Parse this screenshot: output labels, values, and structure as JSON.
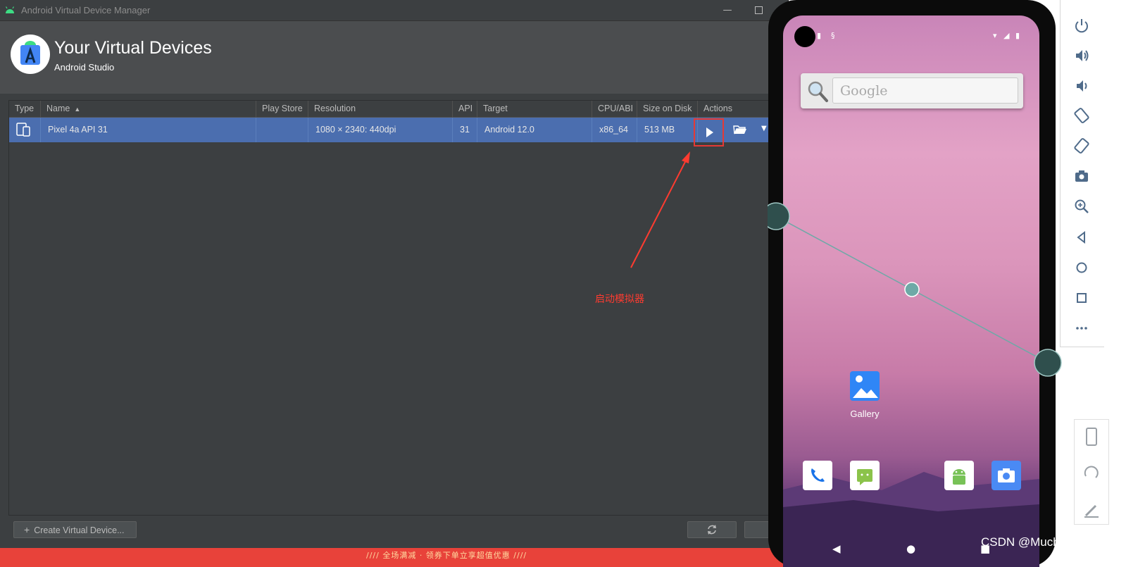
{
  "window": {
    "title": "Android Virtual Device Manager"
  },
  "header": {
    "title": "Your Virtual Devices",
    "subtitle": "Android Studio"
  },
  "table": {
    "columns": [
      "Type",
      "Name",
      "Play Store",
      "Resolution",
      "API",
      "Target",
      "CPU/ABI",
      "Size on Disk",
      "Actions"
    ],
    "sort_column": "Name",
    "rows": [
      {
        "type_icon": "phone-tablet-icon",
        "name": "Pixel 4a API 31",
        "play_store": "",
        "resolution": "1080 × 2340: 440dpi",
        "api": "31",
        "target": "Android 12.0",
        "cpu_abi": "x86_64",
        "size": "513 MB",
        "actions": [
          "play-icon",
          "folder-open-icon",
          "chevron-down-icon"
        ]
      }
    ]
  },
  "footer": {
    "create_label": "Create Virtual Device...",
    "refresh_icon": "refresh-icon"
  },
  "annotation": {
    "text": "启动模拟器",
    "color": "#ff3b30"
  },
  "ad_strip": {
    "text": "//// 全场满减 · 领券下单立享超值优惠 ////"
  },
  "emulator": {
    "search_label": "Google",
    "gallery_label": "Gallery",
    "dock": [
      "phone-icon",
      "messages-icon",
      "android-icon",
      "camera-icon"
    ],
    "toolbar": [
      "power-icon",
      "volume-up-icon",
      "volume-down-icon",
      "rotate-left-icon",
      "rotate-right-icon",
      "camera-icon",
      "zoom-icon",
      "back-icon",
      "home-icon",
      "overview-icon",
      "more-icon"
    ]
  },
  "watermark": "CSDN @Muchen,...",
  "colors": {
    "selected_row": "#4b6eaf",
    "window_bg": "#3c3f41",
    "header_bg": "#4b4d4f",
    "highlight": "#e53935"
  }
}
